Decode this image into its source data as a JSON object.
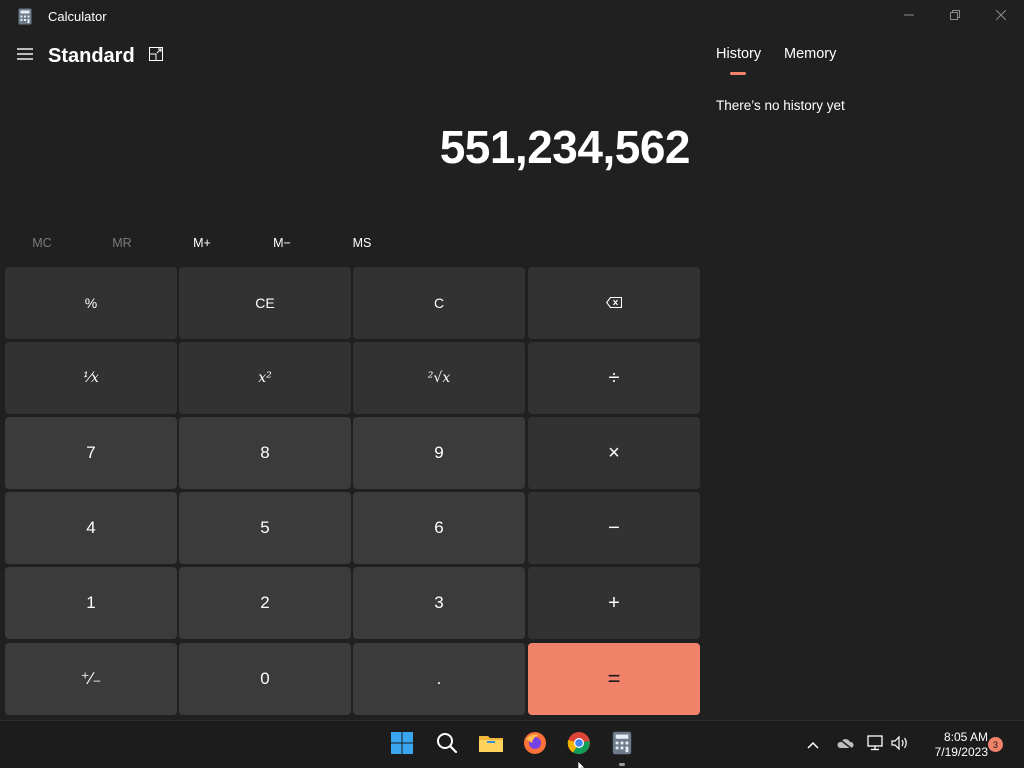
{
  "window": {
    "title": "Calculator"
  },
  "header": {
    "mode": "Standard"
  },
  "display": {
    "value": "551,234,562"
  },
  "memory": {
    "mc": "MC",
    "mr": "MR",
    "mplus": "M+",
    "mminus": "M−",
    "ms": "MS"
  },
  "keys": {
    "percent": "%",
    "ce": "CE",
    "c": "C",
    "backspace": "⌫",
    "reciprocal": "⅟x",
    "square": "x²",
    "sqrt": "²√x",
    "divide": "÷",
    "seven": "7",
    "eight": "8",
    "nine": "9",
    "multiply": "×",
    "four": "4",
    "five": "5",
    "six": "6",
    "minus": "−",
    "one": "1",
    "two": "2",
    "three": "3",
    "plus": "+",
    "negate": "⁺∕₋",
    "zero": "0",
    "decimal": ".",
    "equals": "="
  },
  "panel": {
    "tab_history": "History",
    "tab_memory": "Memory",
    "empty_history": "There’s no history yet"
  },
  "taskbar": {
    "time": "8:05 AM",
    "date": "7/19/2023",
    "notifications": "3"
  },
  "colors": {
    "accent": "#f0826a",
    "background": "#202020",
    "key_number": "#3b3b3b",
    "key_function": "#323232"
  }
}
